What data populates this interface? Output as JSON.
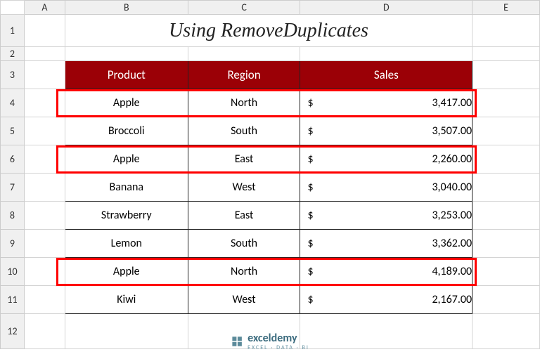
{
  "columns": [
    "A",
    "B",
    "C",
    "D",
    "E"
  ],
  "rowNumbers": [
    "1",
    "2",
    "3",
    "4",
    "5",
    "6",
    "7",
    "8",
    "9",
    "10",
    "11",
    "12"
  ],
  "title": "Using RemoveDuplicates",
  "headers": {
    "product": "Product",
    "region": "Region",
    "sales": "Sales"
  },
  "currency": "$",
  "rows": [
    {
      "product": "Apple",
      "region": "North",
      "sales": "3,417.00",
      "highlight": true
    },
    {
      "product": "Broccoli",
      "region": "South",
      "sales": "3,507.00",
      "highlight": false
    },
    {
      "product": "Apple",
      "region": "East",
      "sales": "2,260.00",
      "highlight": true
    },
    {
      "product": "Banana",
      "region": "West",
      "sales": "3,040.00",
      "highlight": false
    },
    {
      "product": "Strawberry",
      "region": "East",
      "sales": "3,253.00",
      "highlight": false
    },
    {
      "product": "Lemon",
      "region": "South",
      "sales": "3,362.00",
      "highlight": false
    },
    {
      "product": "Apple",
      "region": "North",
      "sales": "4,189.00",
      "highlight": true
    },
    {
      "product": "Kiwi",
      "region": "West",
      "sales": "2,167.00",
      "highlight": false
    }
  ],
  "logo": {
    "brand": "exceldemy",
    "tagline": "EXCEL · DATA · BI"
  },
  "chart_data": {
    "type": "table",
    "title": "Using RemoveDuplicates",
    "columns": [
      "Product",
      "Region",
      "Sales"
    ],
    "data": [
      [
        "Apple",
        "North",
        3417.0
      ],
      [
        "Broccoli",
        "South",
        3507.0
      ],
      [
        "Apple",
        "East",
        2260.0
      ],
      [
        "Banana",
        "West",
        3040.0
      ],
      [
        "Strawberry",
        "East",
        3253.0
      ],
      [
        "Lemon",
        "South",
        3362.0
      ],
      [
        "Apple",
        "North",
        4189.0
      ],
      [
        "Kiwi",
        "West",
        2167.0
      ]
    ]
  }
}
